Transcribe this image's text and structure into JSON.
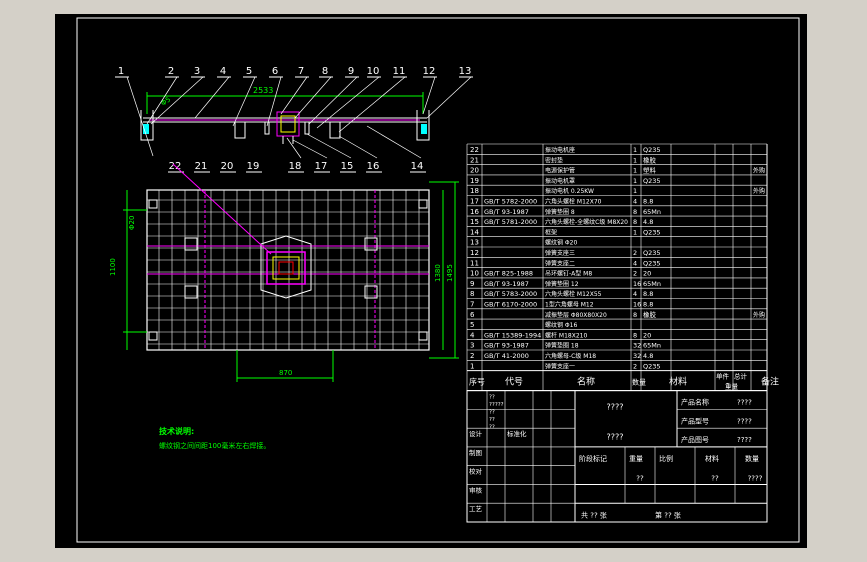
{
  "colors": {
    "background": "#000000",
    "frame": "#ffffff",
    "line": "#ffffff",
    "highlight": "#ff00ff",
    "dimension": "#00ff00",
    "note": "#00ff00",
    "text_yellow": "#ffff00",
    "accent_cyan": "#00ffff"
  },
  "callouts_top": [
    "1",
    "2",
    "3",
    "4",
    "5",
    "6",
    "7",
    "8",
    "9",
    "10",
    "11",
    "12",
    "13"
  ],
  "callouts_bottom": [
    "22",
    "21",
    "20",
    "19",
    "18",
    "17",
    "15",
    "16",
    "14"
  ],
  "dimensions": {
    "top_length": "2533",
    "top_small": "Φ5",
    "left_small": "Φ20",
    "height_inner": "1100",
    "height_mid": "1380",
    "height_outer": "1495",
    "bottom_width": "870"
  },
  "tech_notes": {
    "title": "技术说明:",
    "line1": "螺纹钢之间间距100毫米左右焊接。"
  },
  "bom_rows": [
    {
      "no": "22",
      "code": "",
      "name": "振动电机座",
      "qty": "1",
      "material": "Q235",
      "remark": ""
    },
    {
      "no": "21",
      "code": "",
      "name": "密封垫",
      "qty": "1",
      "material": "橡胶",
      "remark": ""
    },
    {
      "no": "20",
      "code": "",
      "name": "电源保护管",
      "qty": "1",
      "material": "塑料",
      "remark": "外购"
    },
    {
      "no": "19",
      "code": "",
      "name": "振动电机罩",
      "qty": "1",
      "material": "Q235",
      "remark": ""
    },
    {
      "no": "18",
      "code": "",
      "name": "振动电机 0.25KW",
      "qty": "1",
      "material": "",
      "remark": "外购"
    },
    {
      "no": "17",
      "code": "GB/T 5782-2000",
      "name": "六角头螺栓 M12X70",
      "qty": "4",
      "material": "8.8",
      "remark": ""
    },
    {
      "no": "16",
      "code": "GB/T 93-1987",
      "name": "弹簧垫圈 8",
      "qty": "8",
      "material": "65Mn",
      "remark": ""
    },
    {
      "no": "15",
      "code": "GB/T 5781-2000",
      "name": "六角头螺栓-全螺纹C级 M8X20",
      "qty": "8",
      "material": "4.8",
      "remark": ""
    },
    {
      "no": "14",
      "code": "",
      "name": "框架",
      "qty": "1",
      "material": "Q235",
      "remark": ""
    },
    {
      "no": "13",
      "code": "",
      "name": "螺纹钢 Φ20",
      "qty": "",
      "material": "",
      "remark": ""
    },
    {
      "no": "12",
      "code": "",
      "name": "弹簧支座三",
      "qty": "2",
      "material": "Q235",
      "remark": ""
    },
    {
      "no": "11",
      "code": "",
      "name": "弹簧支座二",
      "qty": "4",
      "material": "Q235",
      "remark": ""
    },
    {
      "no": "10",
      "code": "GB/T 825-1988",
      "name": "吊环螺钉-A型 M8",
      "qty": "2",
      "material": "20",
      "remark": ""
    },
    {
      "no": "9",
      "code": "GB/T 93-1987",
      "name": "弹簧垫圈 12",
      "qty": "16",
      "material": "65Mn",
      "remark": ""
    },
    {
      "no": "8",
      "code": "GB/T 5783-2000",
      "name": "六角头螺栓 M12X55",
      "qty": "4",
      "material": "8.8",
      "remark": ""
    },
    {
      "no": "7",
      "code": "GB/T 6170-2000",
      "name": "1型六角螺母 M12",
      "qty": "16",
      "material": "8.8",
      "remark": ""
    },
    {
      "no": "6",
      "code": "",
      "name": "减振垫层 Φ80X80X20",
      "qty": "8",
      "material": "橡胶",
      "remark": "外购"
    },
    {
      "no": "5",
      "code": "",
      "name": "螺纹钢 Φ16",
      "qty": "",
      "material": "",
      "remark": ""
    },
    {
      "no": "4",
      "code": "GB/T 15389-1994",
      "name": "螺杆 M18X210",
      "qty": "8",
      "material": "20",
      "remark": ""
    },
    {
      "no": "3",
      "code": "GB/T 93-1987",
      "name": "弹簧垫圈 18",
      "qty": "32",
      "material": "65Mn",
      "remark": ""
    },
    {
      "no": "2",
      "code": "GB/T 41-2000",
      "name": "六角螺母-C级 M18",
      "qty": "32",
      "material": "4.8",
      "remark": ""
    },
    {
      "no": "1",
      "code": "",
      "name": "弹簧支座一",
      "qty": "2",
      "material": "Q235",
      "remark": ""
    }
  ],
  "bom_header": {
    "no": "序号",
    "code": "代号",
    "name": "名称",
    "qty": "数量",
    "material": "材料",
    "single": "单件",
    "total": "总计",
    "weight": "重量",
    "remark": "备注"
  },
  "title_block": {
    "center1": "????",
    "center2": "????",
    "product_name_label": "产品名称",
    "product_name": "????",
    "product_code_label": "产品型号",
    "product_code": "????",
    "part_label": "产品图号",
    "part": "????",
    "stage_label": "阶段标记",
    "weight_label": "重量",
    "scale_label": "比例",
    "material_label": "材料",
    "count_label": "数量",
    "weight_val": "??",
    "material_val": "??",
    "count_val": "????",
    "design": "设计",
    "drawn": "制图",
    "check": "校对",
    "approve": "审核",
    "process": "工艺",
    "std": "标准化",
    "sheets": "共 ?? 张",
    "sheet_no": "第 ?? 张",
    "rev_cells": [
      "??",
      "?????",
      "??",
      "??",
      "??"
    ]
  }
}
